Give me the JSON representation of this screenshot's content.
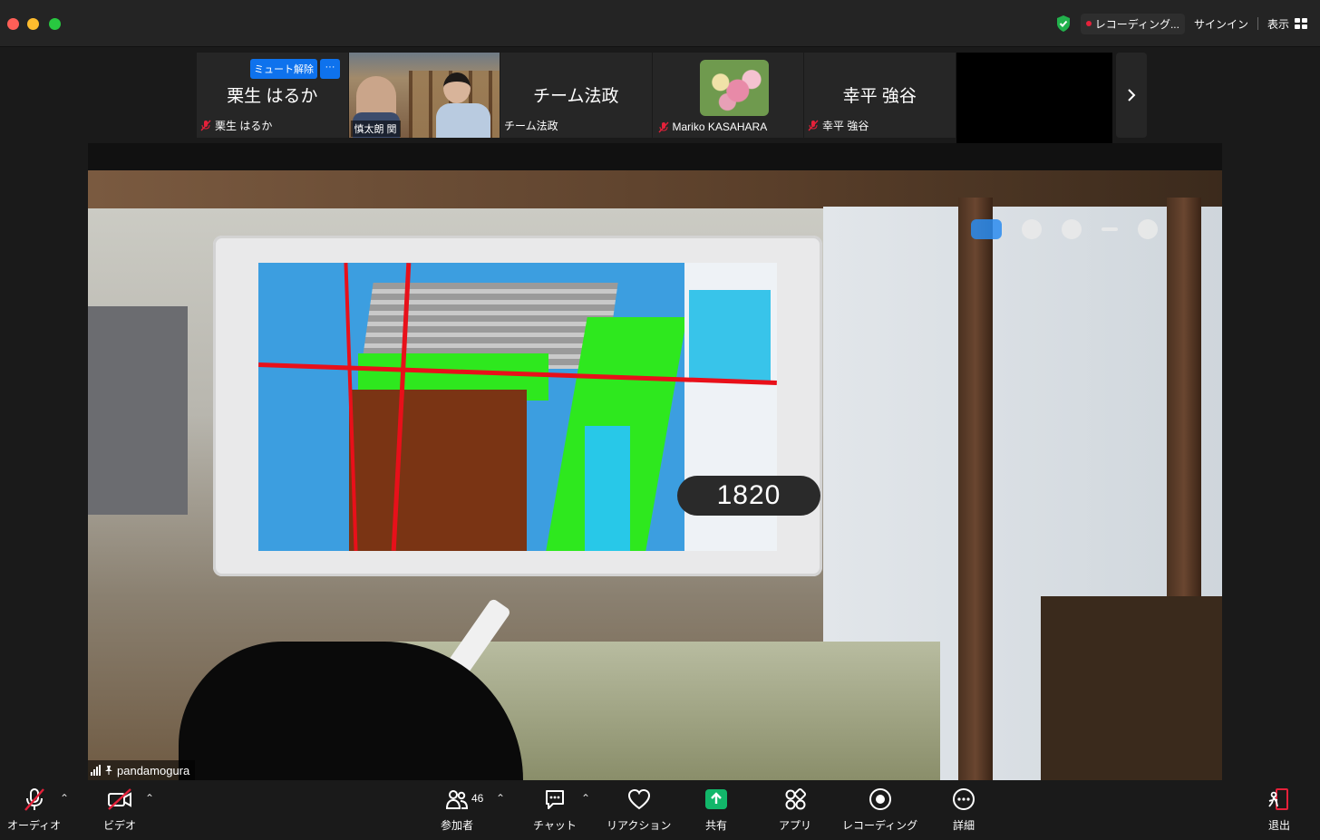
{
  "topbar": {
    "recording_status": "レコーディング...",
    "signin": "サインイン",
    "view": "表示"
  },
  "thumbnails": [
    {
      "name": "栗生 はるか",
      "caption": "栗生 はるか",
      "muted": true,
      "unmute_label": "ミュート解除",
      "more_label": "···"
    },
    {
      "caption": "慎太朗 関",
      "type": "video"
    },
    {
      "name": "チーム法政",
      "caption": "チーム法政",
      "muted": false
    },
    {
      "caption": "Mariko KASAHARA",
      "muted": true,
      "type": "image"
    },
    {
      "name": "幸平 強谷",
      "caption": "幸平 強谷",
      "muted": true
    }
  ],
  "main": {
    "speaker": "pandamogura",
    "measure_label": "1820"
  },
  "toolbar": {
    "audio": "オーディオ",
    "video": "ビデオ",
    "participants": "参加者",
    "participant_count": "46",
    "chat": "チャット",
    "reactions": "リアクション",
    "share": "共有",
    "apps": "アプリ",
    "record": "レコーディング",
    "more": "詳細",
    "leave": "退出"
  },
  "colors": {
    "accent_blue": "#0e72ed",
    "share_green": "#12b76a",
    "leave_red": "#e5213a",
    "mute_red": "#e5213a"
  }
}
